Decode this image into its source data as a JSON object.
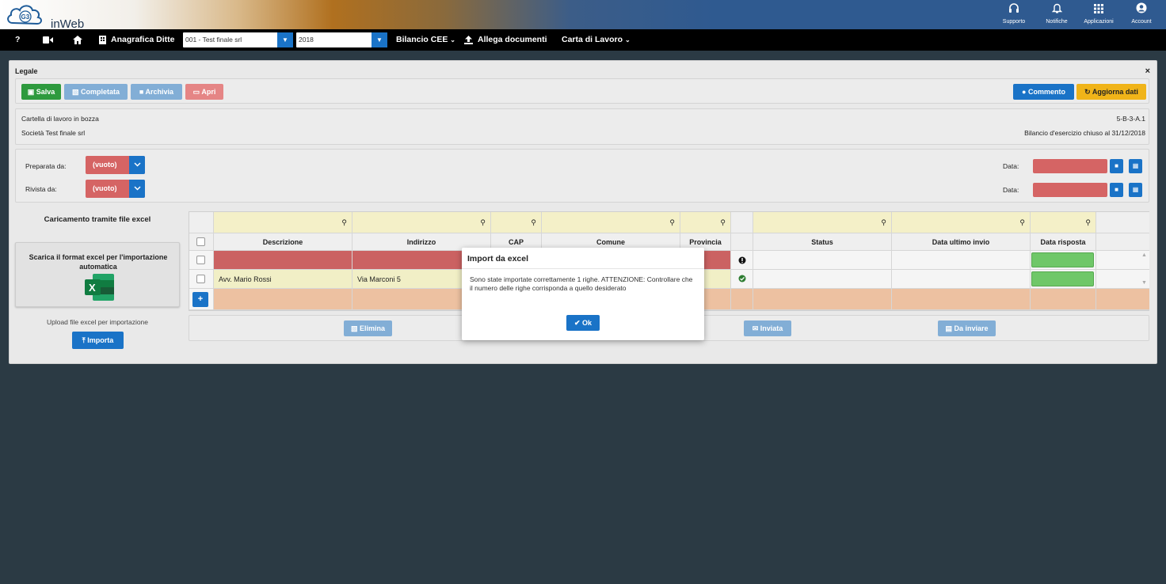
{
  "brand": {
    "name": "inWeb",
    "logo_text": "G3"
  },
  "top_icons": [
    {
      "icon": "headset-icon",
      "label": "Supporto"
    },
    {
      "icon": "bell-icon",
      "label": "Notifiche"
    },
    {
      "icon": "grid-icon",
      "label": "Applicazioni"
    },
    {
      "icon": "user-circle-icon",
      "label": "Account"
    }
  ],
  "nav": {
    "help": "?",
    "anagrafica_label": "Anagrafica Ditte",
    "company_select": "001 - Test finale srl",
    "year_select": "2018",
    "bilancio_label": "Bilancio CEE",
    "allega_label": "Allega documenti",
    "carta_label": "Carta di Lavoro"
  },
  "panel": {
    "title": "Legale",
    "close": "×",
    "buttons": {
      "salva": "Salva",
      "completata": "Completata",
      "archivia": "Archivia",
      "apri": "Apri",
      "commento": "Commento",
      "aggiorna": "Aggiorna dati"
    },
    "info": {
      "status": "Cartella di lavoro in bozza",
      "code": "5-B-3-A.1",
      "company": "Società Test finale srl",
      "bilancio": "Bilancio d'esercizio chiuso al 31/12/2018"
    },
    "prep": {
      "preparata_label": "Preparata da:",
      "preparata_value": "(vuoto)",
      "rivista_label": "Rivista da:",
      "rivista_value": "(vuoto)",
      "data_label": "Data:",
      "data_label2": "Data:"
    },
    "excel": {
      "section_title": "Caricamento tramite file excel",
      "download_text": "Scarica il format excel per l'importazione automatica",
      "upload_text": "Upload file excel per importazione",
      "import_button": "Importa"
    },
    "grid": {
      "columns": [
        "Descrizione",
        "Indirizzo",
        "CAP",
        "Comune",
        "Provincia",
        "",
        "Status",
        "Data ultimo invio",
        "Data risposta"
      ],
      "rows": [
        {
          "descrizione": "",
          "indirizzo": "",
          "status_icon": "exclamation-circle-icon"
        },
        {
          "descrizione": "Avv. Mario Rossi",
          "indirizzo": "Via Marconi 5",
          "status_icon": "check-circle-icon"
        }
      ],
      "add_button": "+",
      "actions": {
        "elimina": "Elimina",
        "inviata": "Inviata",
        "da_inviare": "Da inviare"
      }
    }
  },
  "modal": {
    "title": "Import da excel",
    "body": "Sono state importate correttamente 1 righe. ATTENZIONE: Controllare che il numero delle righe corrisponda a quello desiderato",
    "ok": "Ok"
  },
  "colors": {
    "accent": "#1a73c7",
    "danger": "#d56464",
    "success": "#2e9a3e",
    "warning": "#f0b419",
    "background": "#2b3a44"
  }
}
